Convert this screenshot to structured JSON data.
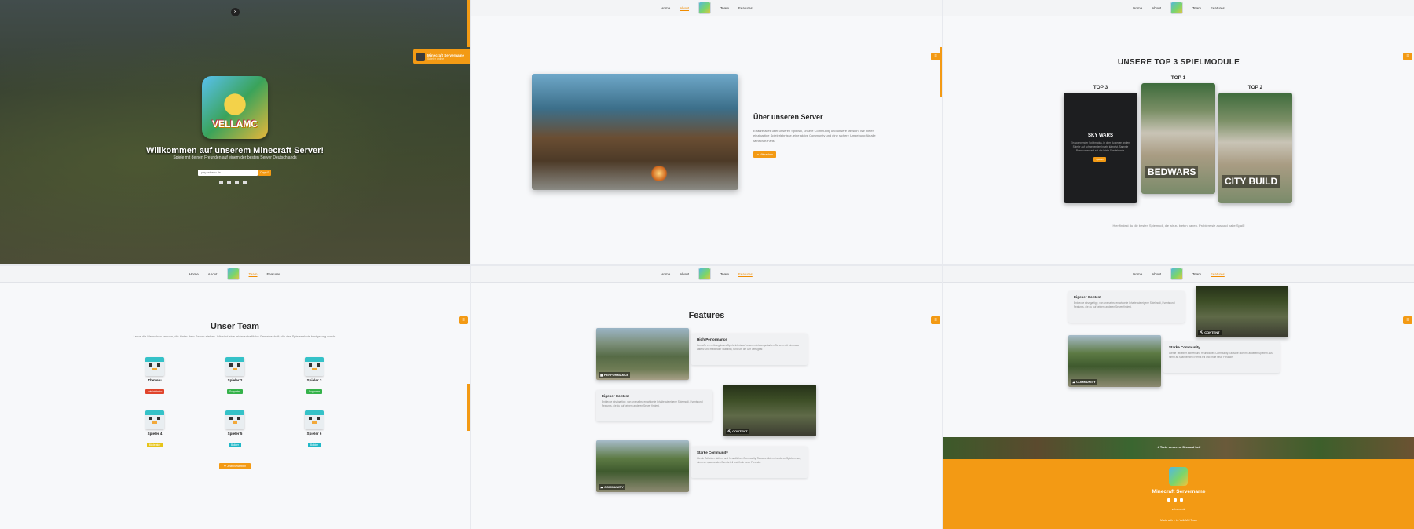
{
  "nav": {
    "home": "Home",
    "about": "About",
    "team": "Team",
    "features": "Features"
  },
  "hero": {
    "close": "×",
    "logo_text": "VELLAMC",
    "title": "Willkommen auf unserem Minecraft Server!",
    "subtitle": "Spiele mit deinen Freunden auf einem der besten Server Deutschlands",
    "ip": "play.velvamc.de",
    "copy_label": "Copy ⧉",
    "server_card_title": "Minecraft Servername",
    "server_card_sub": "Spieler online"
  },
  "about": {
    "title": "Über unseren Server",
    "text": "Erfahre alles über unseren Spielstil, unsere Community und unsere Mission. Wir bieten einzigartige Spielerlebnisse, eine aktive Community und eine sichere Umgebung für alle Minecraft-Fans.",
    "button": "⇗ Mitmachen"
  },
  "top_modules": {
    "title": "UNSERE TOP 3 SPIELMODULE",
    "top3_label": "TOP 3",
    "top1_label": "TOP 1",
    "top2_label": "TOP 2",
    "top3_name": "SKY WARS",
    "top3_desc": "Ein spannender Spielmodus, in dem du gegen andere Spieler auf schwebenden Inseln kämpfst. Sammle Ressourcen und sei der letzte Überlebende.",
    "top3_button": "Spielen",
    "top1_name": "BEDWARS",
    "top2_name": "CITY BUILD",
    "note": "Hier findest du die besten Spielmodi, die wir zu bieten haben. Probiere sie aus und habe Spaß!"
  },
  "team": {
    "title": "Unser Team",
    "subtitle": "Lerne die Menschen kennen, die hinter dem Server stehen. Wir sind eine leidenschaftliche Gemeinschaft, die das Spielerlebnis bestgelung macht.",
    "members": [
      {
        "name": "TheVelu",
        "role": "Administrator",
        "color": "#e0442b"
      },
      {
        "name": "Spieler 2",
        "role": "Supporter",
        "color": "#35b24a"
      },
      {
        "name": "Spieler 3",
        "role": "Supporter",
        "color": "#35b24a"
      },
      {
        "name": "Spieler 4",
        "role": "Moderator",
        "color": "#e6c419"
      },
      {
        "name": "Spieler 5",
        "role": "Builder",
        "color": "#20b8c8"
      },
      {
        "name": "Spieler 6",
        "role": "Builder",
        "color": "#20b8c8"
      }
    ],
    "button": "✚ Jetzt Bewerben"
  },
  "features": {
    "title": "Features",
    "items": [
      {
        "tag": "▦ PERFORMANCE",
        "title": "High Performance",
        "text": "Genieße ein reibungsloses Spielerlebnis auf unseren leistungsstarken Servern mit minimaler Latenz und maximaler Stabilität, rund um die Uhr verfügbar."
      },
      {
        "tag": "⛏ CONTENT",
        "title": "Eigener Content",
        "text": "Entdecke einzigartige, von uns selbst entwickelte Inhalte wie eigene Spielmodi, Events und Features, die du auf keinem anderen Server findest."
      },
      {
        "tag": "☁ COMMUNITY",
        "title": "Starke Community",
        "text": "Werde Teil einer aktiven und freundlichen Community. Tausche dich mit anderen Spielern aus, nimm an spannenden Events teil und finde neue Freunde."
      }
    ]
  },
  "footer": {
    "discord_strip": "➜ Trete unserem Discord bei!",
    "name": "Minecraft Servername",
    "line": "velvamc.de",
    "copyright": "Made with ♥ by VelluMC Team"
  },
  "colors": {
    "accent": "#f39a14",
    "background": "#f7f8fa",
    "text": "#222222"
  }
}
